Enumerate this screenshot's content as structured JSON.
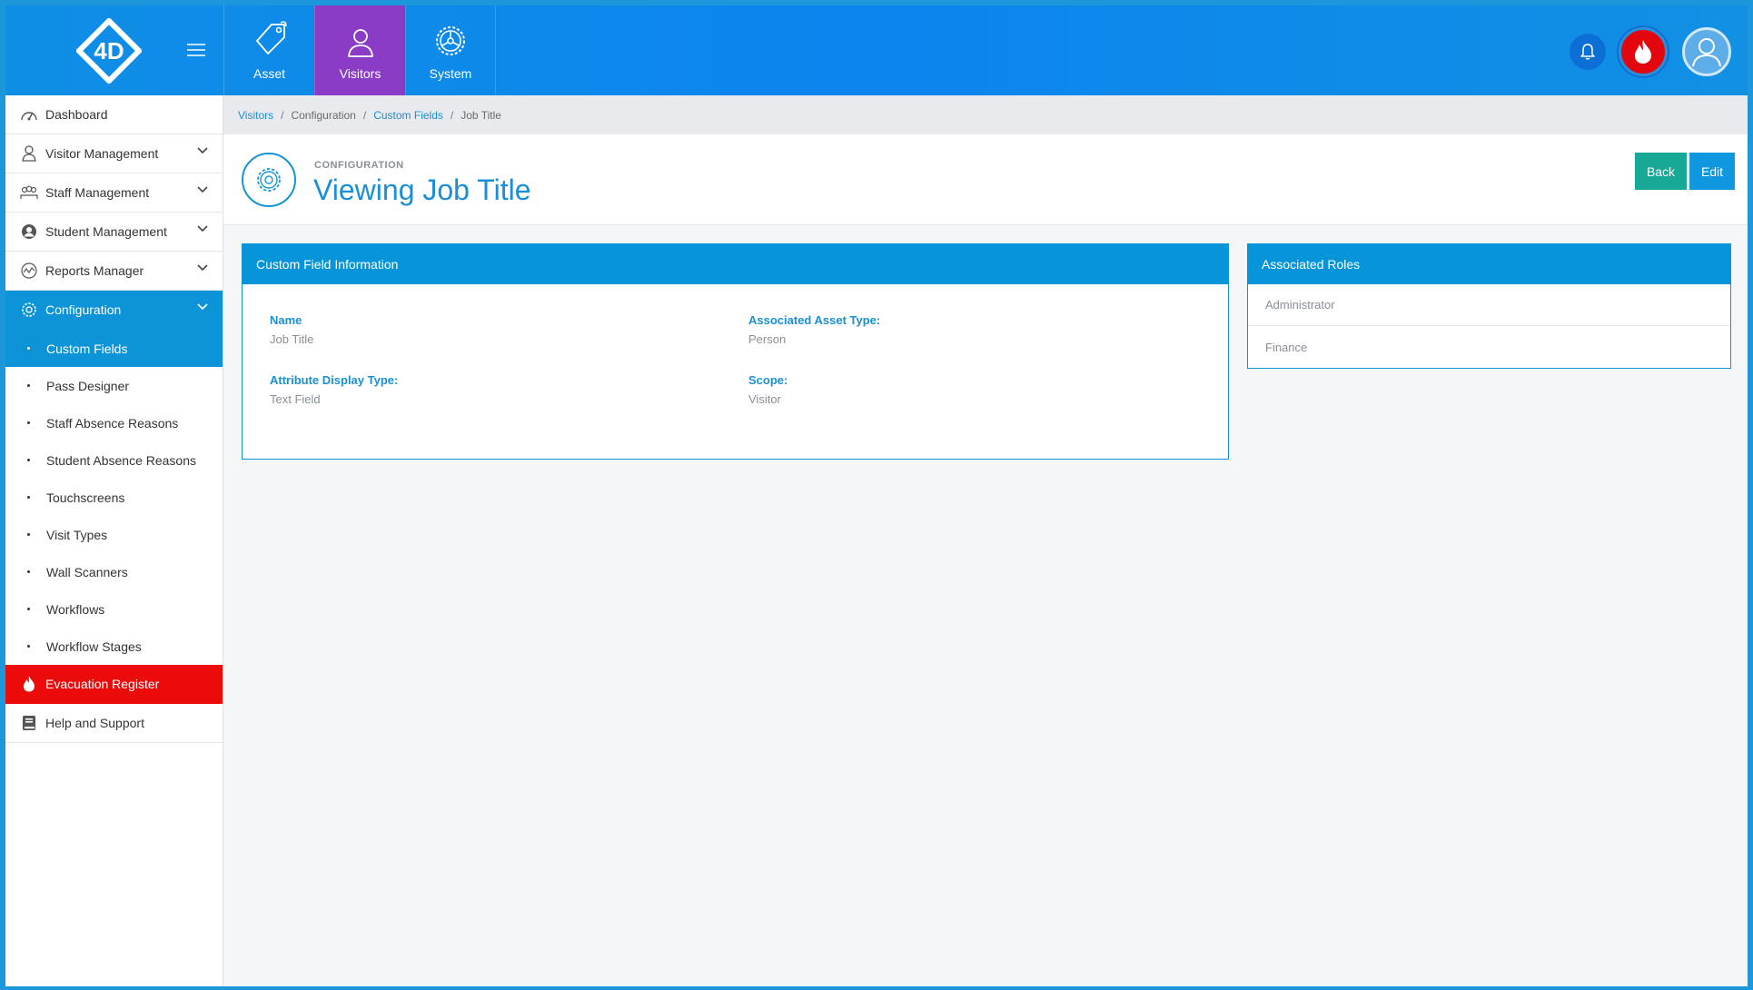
{
  "colors": {
    "topbar": "#0f8ee6",
    "active_nav": "#8a3cc6",
    "primary": "#0d94d8",
    "evacuation": "#ec0b0b",
    "back_button": "#18a896"
  },
  "topnav": {
    "items": [
      {
        "label": "Asset",
        "icon": "tag-icon"
      },
      {
        "label": "Visitors",
        "icon": "person-icon"
      },
      {
        "label": "System",
        "icon": "gear-icon"
      }
    ],
    "active": "Visitors"
  },
  "sidebar": {
    "items": [
      {
        "label": "Dashboard",
        "icon": "gauge-icon"
      },
      {
        "label": "Visitor Management",
        "icon": "person-icon"
      },
      {
        "label": "Staff Management",
        "icon": "group-icon"
      },
      {
        "label": "Student Management",
        "icon": "user-circle-icon"
      },
      {
        "label": "Reports Manager",
        "icon": "chart-icon"
      },
      {
        "label": "Configuration",
        "icon": "gear-icon"
      }
    ],
    "submenu": [
      "Custom Fields",
      "Pass Designer",
      "Staff Absence Reasons",
      "Student Absence Reasons",
      "Touchscreens",
      "Visit Types",
      "Wall Scanners",
      "Workflows",
      "Workflow Stages"
    ],
    "evacuation": "Evacuation Register",
    "help": "Help and Support"
  },
  "breadcrumb": [
    "Visitors",
    "Configuration",
    "Custom Fields",
    "Job Title"
  ],
  "header": {
    "kicker": "CONFIGURATION",
    "title": "Viewing Job Title",
    "back_label": "Back",
    "edit_label": "Edit"
  },
  "info_panel": {
    "title": "Custom Field Information",
    "fields": {
      "name_label": "Name",
      "name_value": "Job Title",
      "asset_type_label": "Associated Asset Type:",
      "asset_type_value": "Person",
      "display_type_label": "Attribute Display Type:",
      "display_type_value": "Text Field",
      "scope_label": "Scope:",
      "scope_value": "Visitor"
    }
  },
  "roles_panel": {
    "title": "Associated Roles",
    "roles": [
      "Administrator",
      "Finance"
    ]
  }
}
